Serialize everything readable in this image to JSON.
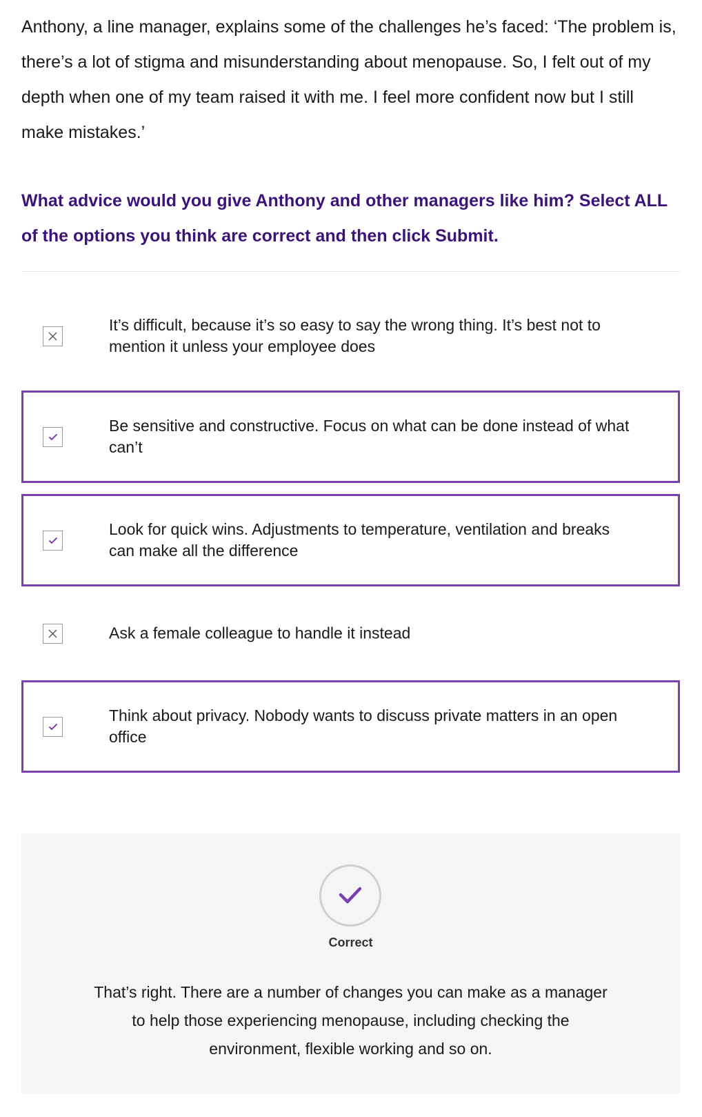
{
  "intro": "Anthony, a line manager, explains some of the challenges he’s faced: ‘The problem is, there’s a lot of stigma and misunderstanding about menopause. So, I felt out of my depth when one of my team raised it with me. I feel more confident now but I still make mistakes.’",
  "question": "What advice would you give Anthony and other managers like him? Select ALL of the options you think are correct and then click Submit.",
  "options": [
    {
      "label": "It’s difficult, because it’s so easy to say the wrong thing. It’s best not to mention it unless your employee does",
      "state": "unselected",
      "icon": "cross-icon"
    },
    {
      "label": "Be sensitive and constructive. Focus on what can be done instead of what can’t",
      "state": "selected",
      "icon": "check-icon"
    },
    {
      "label": "Look for quick wins. Adjustments to temperature, ventilation and breaks can make all the difference",
      "state": "selected",
      "icon": "check-icon"
    },
    {
      "label": "Ask a female colleague to handle it instead",
      "state": "unselected",
      "icon": "cross-icon"
    },
    {
      "label": "Think about privacy. Nobody wants to discuss private matters in an open office",
      "state": "selected",
      "icon": "check-icon"
    }
  ],
  "feedback": {
    "icon": "check-icon",
    "label": "Correct",
    "text": "That’s right. There are a number of changes you can make as a manager to help those experiencing menopause, including checking the environment, flexible working and so on."
  },
  "colors": {
    "accent": "#7a3fb0",
    "question": "#3c1477",
    "feedback_bg": "#f5f5f5"
  }
}
